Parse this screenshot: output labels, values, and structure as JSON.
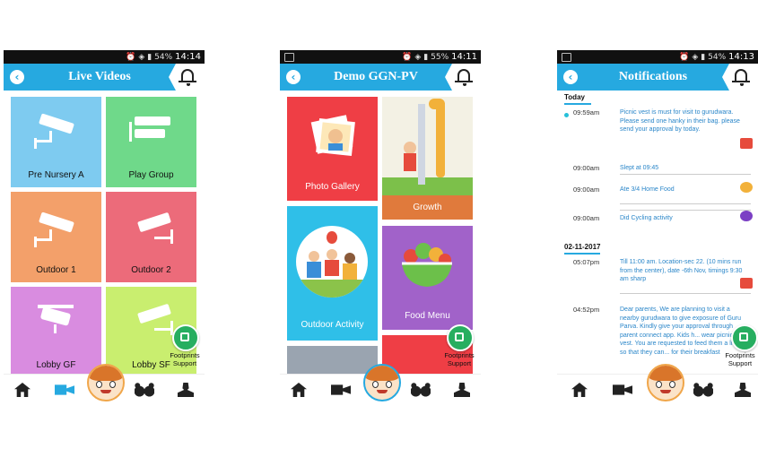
{
  "status": {
    "battery": "54%",
    "battery2": "55%",
    "times": [
      "14:14",
      "14:11",
      "14:13"
    ]
  },
  "phone1": {
    "title": "Live Videos",
    "tiles": [
      {
        "label": "Pre Nursery A",
        "color": "#7ecbf0"
      },
      {
        "label": "Play Group",
        "color": "#6fd98a"
      },
      {
        "label": "Outdoor 1",
        "color": "#f3a06a"
      },
      {
        "label": "Outdoor 2",
        "color": "#ec6b7a"
      },
      {
        "label": "Lobby GF",
        "color": "#d98ce0"
      },
      {
        "label": "Lobby SF",
        "color": "#c9ee6f"
      }
    ]
  },
  "phone2": {
    "title": "Demo GGN-PV",
    "tiles": [
      {
        "label": "Photo Gallery",
        "color": "#ef3e45"
      },
      {
        "label": "Growth",
        "color": "#e07a3c"
      },
      {
        "label": "Outdoor Activity",
        "color": "#2fbfe8"
      },
      {
        "label": "Food Menu",
        "color": "#a162c9"
      }
    ]
  },
  "phone3": {
    "title": "Notifications",
    "sections": [
      "Today",
      "02-11-2017"
    ],
    "items": [
      {
        "time": "09:59am",
        "text": "Picnic vest is must for visit to gurudwara. Please send one hanky in their bag. please send your approval by today."
      },
      {
        "time": "09:00am",
        "text": "Slept at 09:45"
      },
      {
        "time": "09:00am",
        "text": "Ate 3/4 Home Food"
      },
      {
        "time": "09:00am",
        "text": "Did Cycling activity"
      },
      {
        "time": "05:07pm",
        "text": "Till 11:00 am. Location-sec 22. (10 mins run from the center), date -6th Nov, timings 9:30 am sharp"
      },
      {
        "time": "04:52pm",
        "text": "Dear parents, We are planning to visit a nearby gurudwara to give exposure of Guru Parva. Kindly give your approval through parent connect app. Kids h... wear picnic vest. You are requested to feed them a little so that they can... for their breakfast"
      }
    ]
  },
  "fab": {
    "label_line1": "Footprints",
    "label_line2": "Support"
  },
  "colors": {
    "accent": "#26a9e0",
    "fab": "#27ae60"
  }
}
